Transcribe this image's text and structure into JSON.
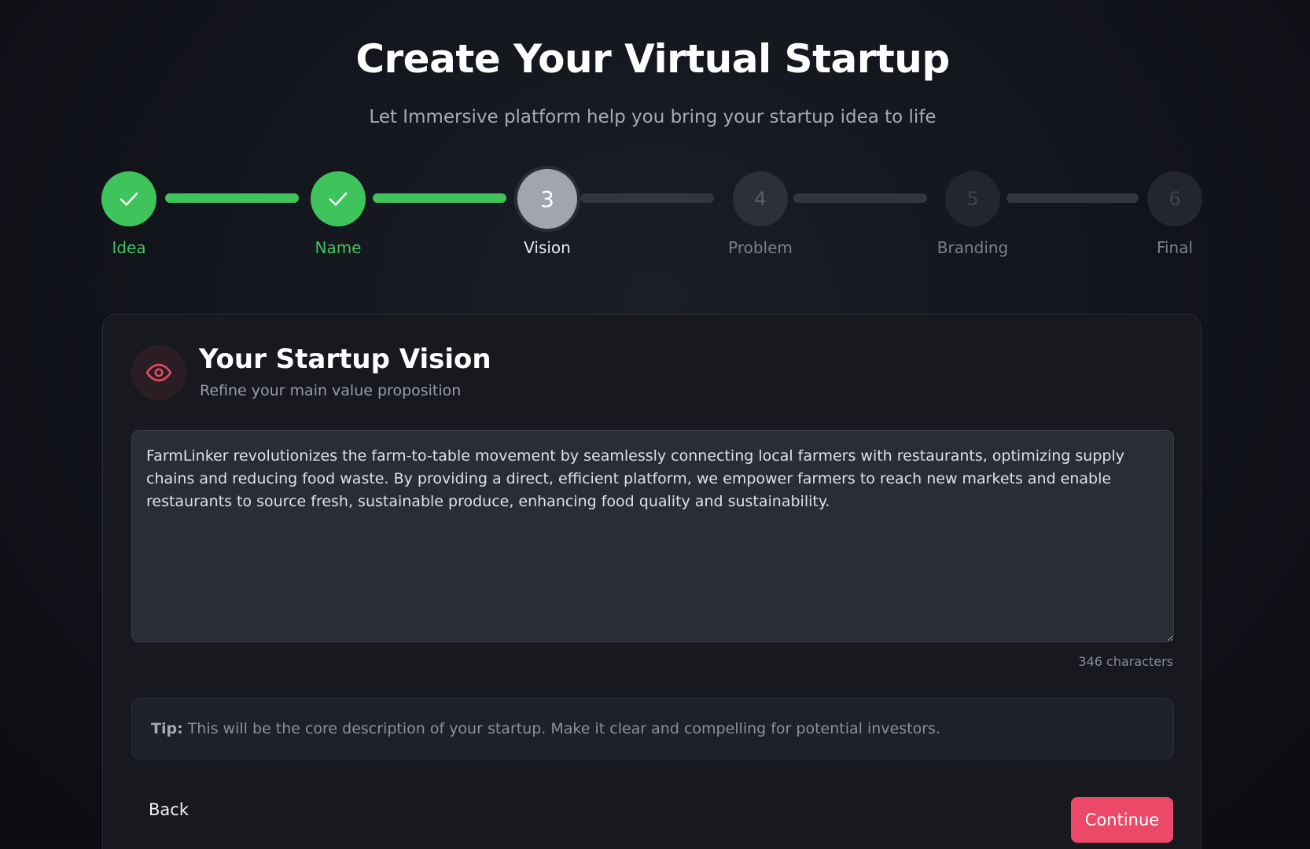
{
  "header": {
    "title": "Create Your Virtual Startup",
    "subtitle": "Let Immersive platform help you bring your startup idea to life"
  },
  "stepper": {
    "steps": [
      {
        "number": "1",
        "label": "Idea",
        "status": "done"
      },
      {
        "number": "2",
        "label": "Name",
        "status": "done"
      },
      {
        "number": "3",
        "label": "Vision",
        "status": "current"
      },
      {
        "number": "4",
        "label": "Problem",
        "status": "todo"
      },
      {
        "number": "5",
        "label": "Branding",
        "status": "todo"
      },
      {
        "number": "6",
        "label": "Final",
        "status": "todo"
      }
    ],
    "check_icon": "check-icon"
  },
  "card": {
    "icon": "eye-icon",
    "title": "Your Startup Vision",
    "subtitle": "Refine your main value proposition",
    "vision_text": "FarmLinker revolutionizes the farm-to-table movement by seamlessly connecting local farmers with restaurants, optimizing supply chains and reducing food waste. By providing a direct, efficient platform, we empower farmers to reach new markets and enable restaurants to source fresh, sustainable produce, enhancing food quality and sustainability.",
    "char_count": "346 characters",
    "tip_label": "Tip:",
    "tip_text": "This will be the core description of your startup. Make it clear and compelling for potential investors."
  },
  "actions": {
    "back_label": "Back",
    "continue_label": "Continue"
  },
  "colors": {
    "success": "#3fc45b",
    "accent": "#ec4867",
    "background": "#12141b"
  }
}
